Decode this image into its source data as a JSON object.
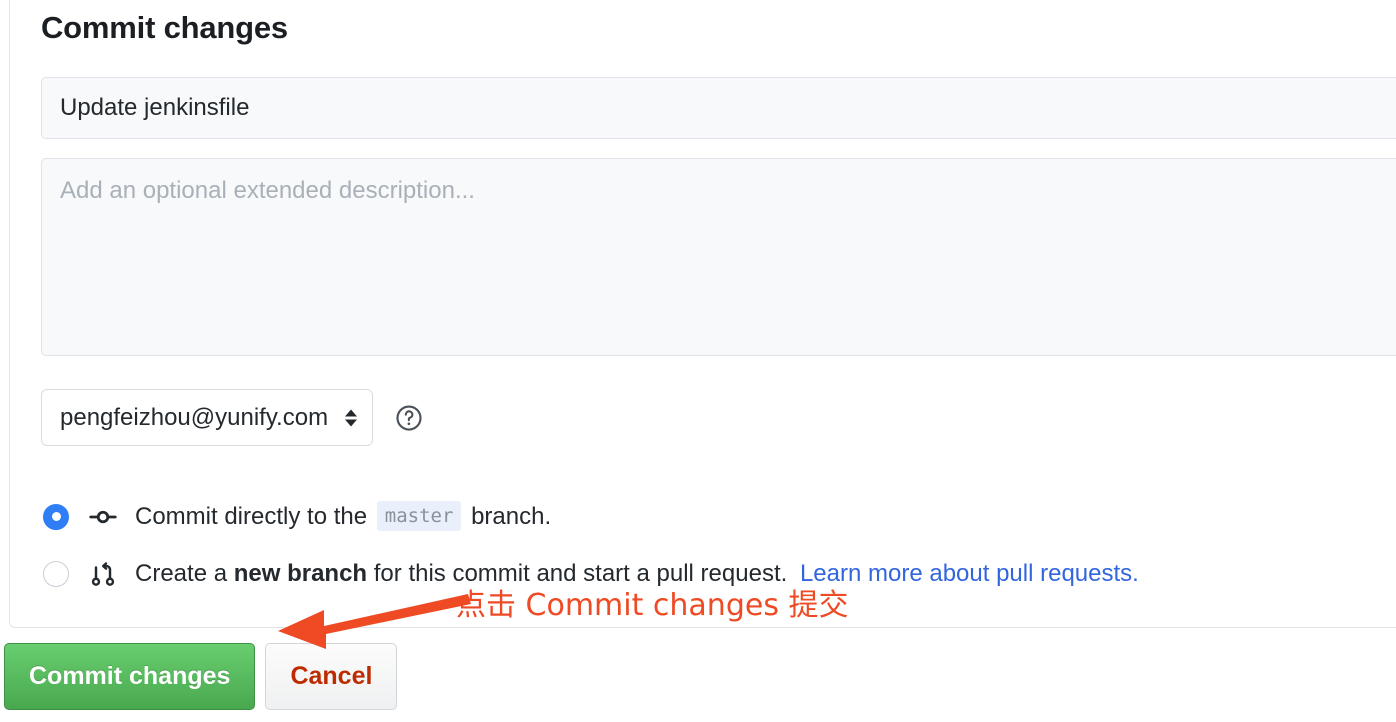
{
  "panel": {
    "title": "Commit changes",
    "commit_title": {
      "value": "Update jenkinsfile",
      "placeholder": "Update jenkinsfile"
    },
    "commit_description": {
      "value": "",
      "placeholder": "Add an optional extended description..."
    },
    "email_select": {
      "value": "pengfeizhou@yunify.com",
      "options": [
        "pengfeizhou@yunify.com"
      ]
    },
    "help_icon": "question-circle-icon"
  },
  "options": {
    "direct": {
      "icon": "git-commit-icon",
      "text_before": "Commit directly to the",
      "branch": "master",
      "text_after": "branch.",
      "selected": true
    },
    "new_branch": {
      "icon": "git-pull-request-icon",
      "text_before": "Create a",
      "emphasis": "new branch",
      "text_after": "for this commit and start a pull request.",
      "link": "Learn more about pull requests.",
      "selected": false
    }
  },
  "actions": {
    "commit_label": "Commit changes",
    "cancel_label": "Cancel"
  },
  "annotation": {
    "text": "点击 Commit changes 提交",
    "arrow": "arrow-pointing-left"
  },
  "colors": {
    "accent_blue": "#2f7ef5",
    "link_blue": "#3366dd",
    "commit_green": "#49a84f",
    "cancel_red": "#bd2c00",
    "annotation_orange": "#ee4b25",
    "field_bg": "#f7f9fb"
  }
}
